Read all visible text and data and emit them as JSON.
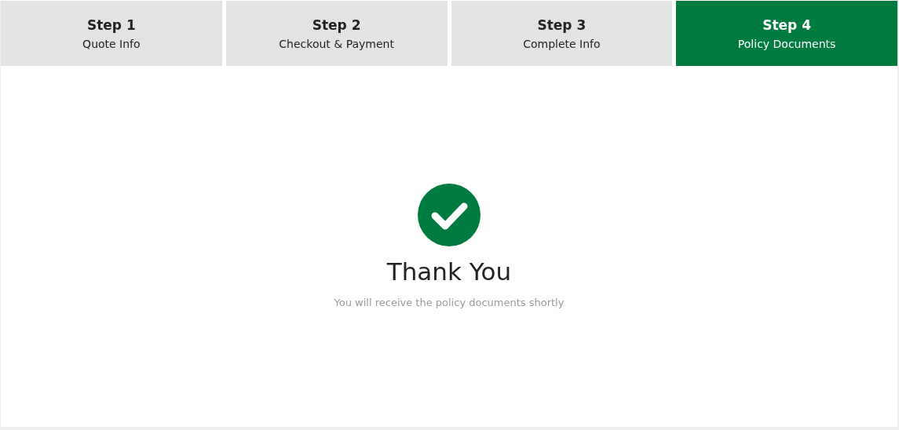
{
  "steps": [
    {
      "title": "Step 1",
      "subtitle": "Quote Info",
      "selected": false
    },
    {
      "title": "Step 2",
      "subtitle": "Checkout & Payment",
      "selected": false
    },
    {
      "title": "Step 3",
      "subtitle": "Complete Info",
      "selected": false
    },
    {
      "title": "Step 4",
      "subtitle": "Policy Documents",
      "selected": true
    }
  ],
  "confirmation": {
    "title": "Thank You",
    "message": "You will receive the policy documents shortly"
  }
}
